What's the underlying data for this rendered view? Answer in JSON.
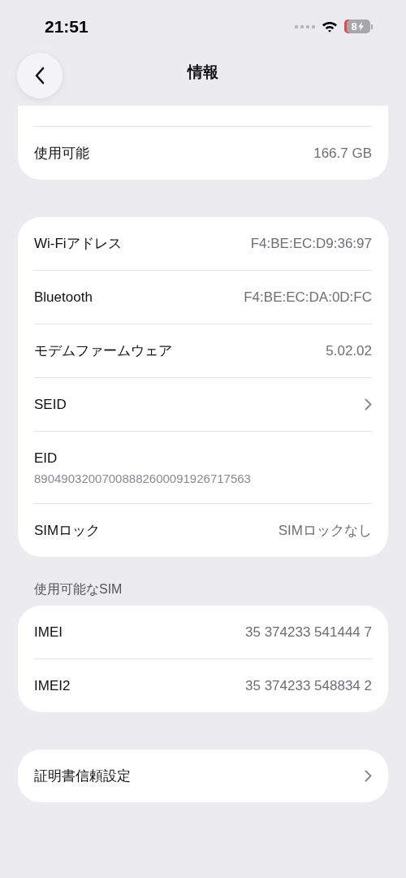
{
  "status_bar": {
    "time": "21:51",
    "battery": "8"
  },
  "nav": {
    "title": "情報"
  },
  "sections": [
    {
      "cut_top": true,
      "rows": [
        {
          "kind": "value",
          "label": "使用可能",
          "value": "166.7 GB"
        }
      ]
    },
    {
      "rows": [
        {
          "kind": "value",
          "label": "Wi-Fiアドレス",
          "value": "F4:BE:EC:D9:36:97"
        },
        {
          "kind": "value",
          "label": "Bluetooth",
          "value": "F4:BE:EC:DA:0D:FC"
        },
        {
          "kind": "value",
          "label": "モデムファームウェア",
          "value": "5.02.02"
        },
        {
          "kind": "link",
          "label": "SEID"
        },
        {
          "kind": "stacked",
          "label": "EID",
          "value": "89049032007008882600091926717563"
        },
        {
          "kind": "value",
          "label": "SIMロック",
          "value": "SIMロックなし"
        }
      ]
    },
    {
      "header": "使用可能なSIM",
      "rows": [
        {
          "kind": "value",
          "label": "IMEI",
          "value": "35 374233 541444 7"
        },
        {
          "kind": "value",
          "label": "IMEI2",
          "value": "35 374233 548834 2"
        }
      ]
    },
    {
      "rows": [
        {
          "kind": "link",
          "label": "証明書信頼設定"
        }
      ]
    }
  ]
}
